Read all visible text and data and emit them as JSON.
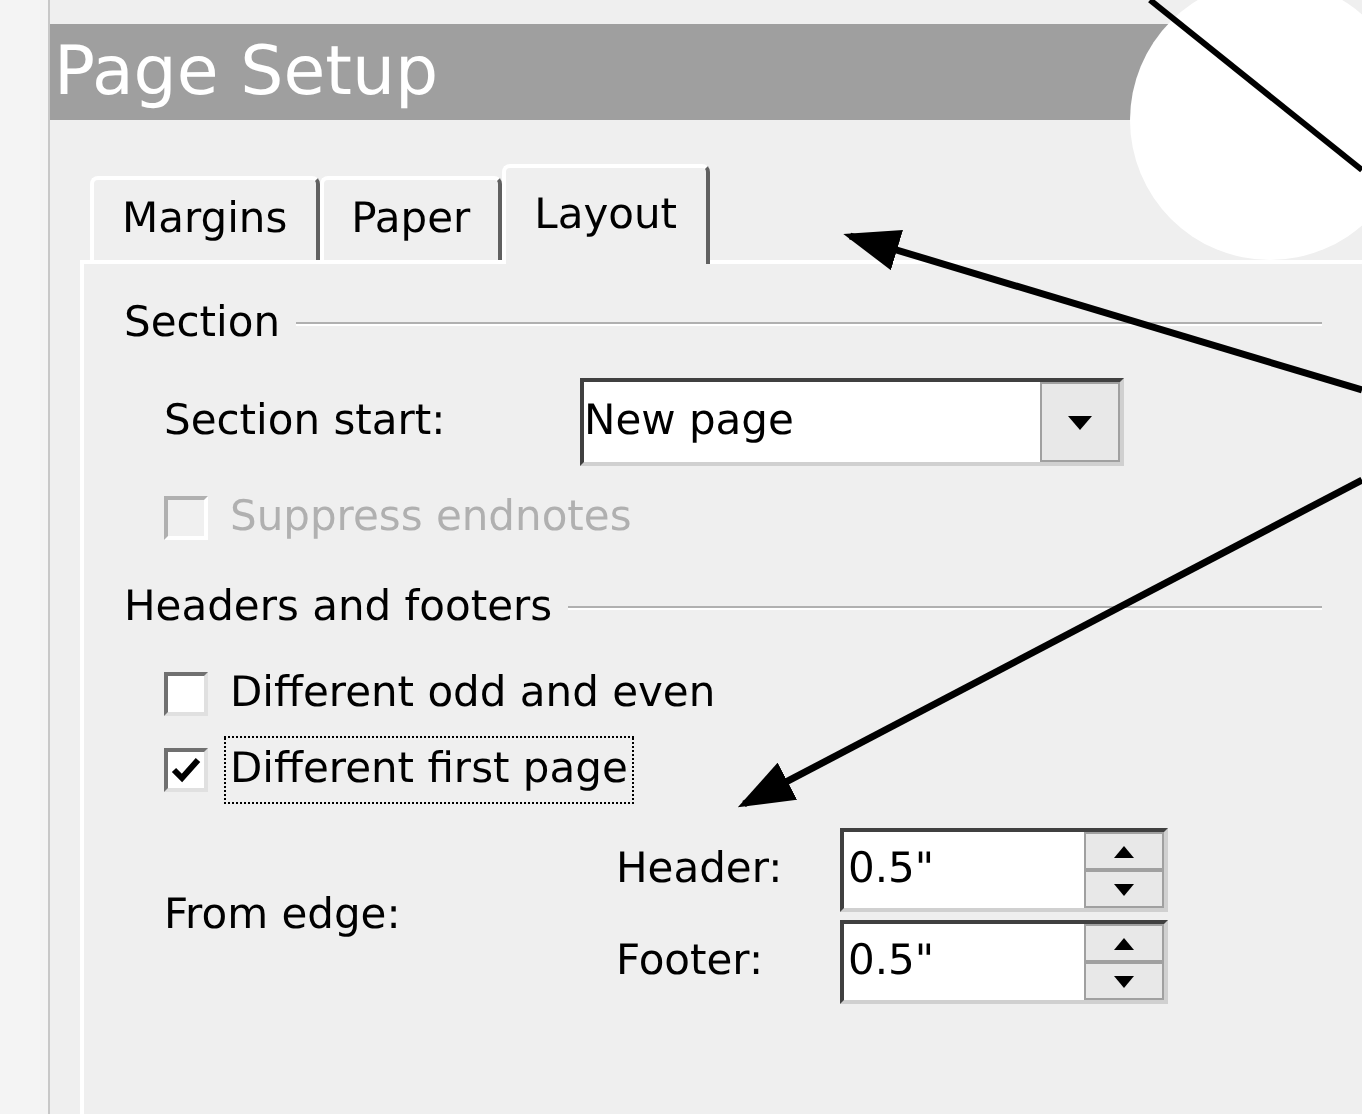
{
  "window": {
    "title": "Page Setup"
  },
  "tabs": [
    {
      "label": "Margins",
      "selected": false
    },
    {
      "label": "Paper",
      "selected": false
    },
    {
      "label": "Layout",
      "selected": true
    }
  ],
  "section": {
    "heading": "Section",
    "section_start": {
      "label": "Section start:",
      "value": "New page"
    },
    "checkboxes": [
      {
        "label": "Suppress endnotes",
        "checked": false,
        "disabled": true,
        "focused": false
      }
    ]
  },
  "headers_footers": {
    "heading": "Headers and footers",
    "checkboxes": [
      {
        "label": "Different odd and even",
        "checked": false,
        "disabled": false,
        "focused": false
      },
      {
        "label": "Different first page",
        "checked": true,
        "disabled": false,
        "focused": true
      }
    ],
    "from_edge": {
      "label": "From edge:",
      "fields": [
        {
          "label": "Header:",
          "value": "0.5\""
        },
        {
          "label": "Footer:",
          "value": "0.5\""
        }
      ]
    }
  }
}
